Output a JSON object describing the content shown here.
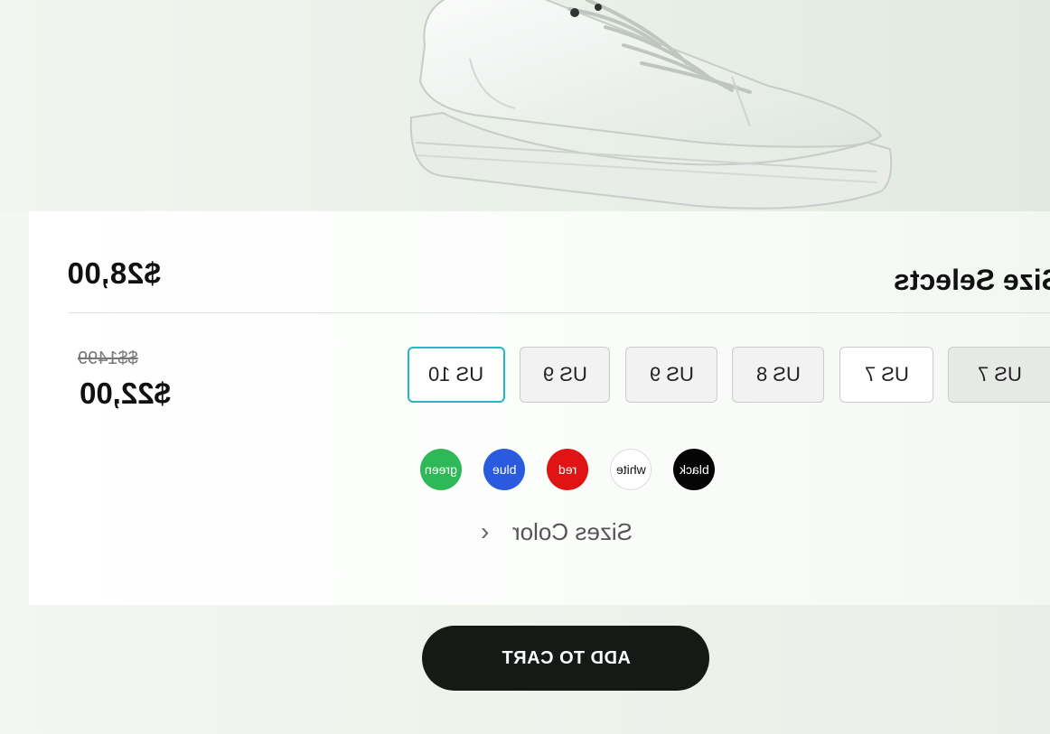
{
  "product": {
    "image_name": "white-sneaker",
    "price_top": "$28,00",
    "price_old": "$$1499",
    "price_new": "$22,00"
  },
  "sizes": {
    "title": "Size Selects",
    "options": [
      "US 10",
      "US 9",
      "US 9",
      "US 8",
      "US 7",
      "US 7"
    ],
    "selected": "US 10"
  },
  "colors": {
    "options": [
      "green",
      "blue",
      "red",
      "white",
      "black"
    ]
  },
  "nav": {
    "sizes_color_label": "Sizes Color",
    "chevron_icon": "chevron-right-icon"
  },
  "cart": {
    "button_label": "ADD TO CART"
  },
  "theme": {
    "accent": "#2ab5c4",
    "button_bg": "#161a17"
  }
}
